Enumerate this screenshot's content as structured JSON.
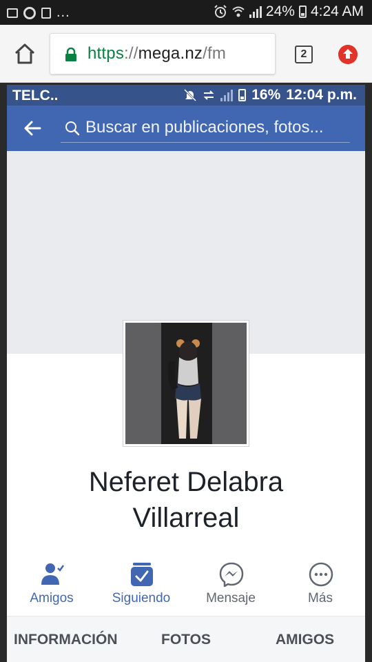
{
  "os_status": {
    "overflow": "...",
    "battery": "24%",
    "time": "4:24 AM"
  },
  "browser": {
    "url_scheme": "https",
    "url_sep": "://",
    "url_host": "mega.nz",
    "url_path": "/fm",
    "tab_count": "2",
    "colors": {
      "secure": "#0b8043",
      "upload": "#e0332a"
    }
  },
  "fb": {
    "status": {
      "carrier": "TELC..",
      "battery": "16%",
      "time": "12:04 p.m."
    },
    "search_placeholder": "Buscar en publicaciones, fotos...",
    "profile": {
      "name_line1": "Neferet Delabra",
      "name_line2": "Villarreal"
    },
    "actions": [
      {
        "label": "Amigos",
        "icon": "friends-check-icon"
      },
      {
        "label": "Siguiendo",
        "icon": "following-check-icon"
      },
      {
        "label": "Mensaje",
        "icon": "messenger-icon"
      },
      {
        "label": "Más",
        "icon": "more-icon"
      }
    ],
    "tabs": [
      {
        "label": "INFORMACIÓN"
      },
      {
        "label": "FOTOS"
      },
      {
        "label": "AMIGOS"
      }
    ],
    "colors": {
      "nav": "#4267b2",
      "status": "#37538c",
      "cover": "#e9ebee"
    }
  }
}
